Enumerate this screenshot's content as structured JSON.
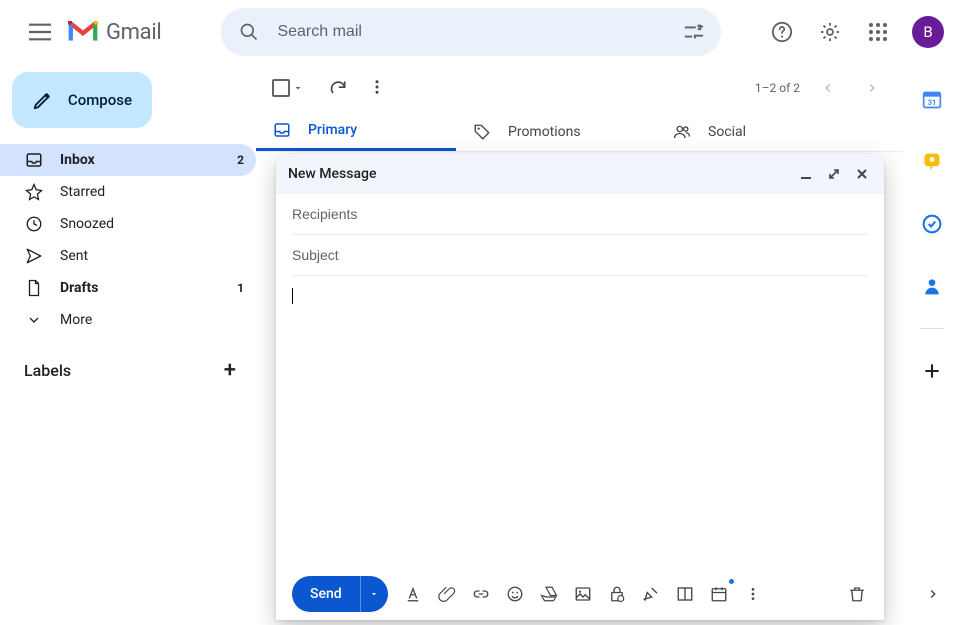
{
  "app": {
    "name": "Gmail"
  },
  "search": {
    "placeholder": "Search mail"
  },
  "compose_button": "Compose",
  "avatar": "B",
  "nav": [
    {
      "icon": "inbox",
      "label": "Inbox",
      "count": "2",
      "active": true,
      "bold": true
    },
    {
      "icon": "star",
      "label": "Starred",
      "count": "",
      "active": false,
      "bold": false
    },
    {
      "icon": "snooze",
      "label": "Snoozed",
      "count": "",
      "active": false,
      "bold": false
    },
    {
      "icon": "sent",
      "label": "Sent",
      "count": "",
      "active": false,
      "bold": false
    },
    {
      "icon": "drafts",
      "label": "Drafts",
      "count": "1",
      "active": false,
      "bold": true
    },
    {
      "icon": "more",
      "label": "More",
      "count": "",
      "active": false,
      "bold": false
    }
  ],
  "labels_header": "Labels",
  "toolbar": {
    "page_info": "1–2 of 2"
  },
  "tabs": [
    {
      "icon": "inbox",
      "label": "Primary",
      "active": true
    },
    {
      "icon": "tag",
      "label": "Promotions",
      "active": false
    },
    {
      "icon": "people",
      "label": "Social",
      "active": false
    }
  ],
  "compose": {
    "title": "New Message",
    "recipients_placeholder": "Recipients",
    "subject_placeholder": "Subject",
    "send_label": "Send"
  },
  "calendar_day": "31"
}
